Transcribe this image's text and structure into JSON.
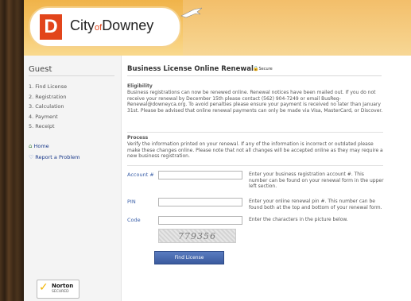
{
  "header": {
    "logo_letter": "D",
    "logo_city": "City",
    "logo_of": "of",
    "logo_name": "Downey"
  },
  "sidebar": {
    "heading": "Guest",
    "steps": [
      "1. Find License",
      "2. Registration",
      "3. Calculation",
      "4. Payment",
      "5. Receipt"
    ],
    "home_link": "Home",
    "report_link": "Report a Problem",
    "norton_title": "Norton",
    "norton_sub": "SECURED"
  },
  "main": {
    "title": "Business License Online Renewal",
    "secure_label": "Secure",
    "eligibility_heading": "Eligibility",
    "eligibility_text": "Business registrations can now be renewed online. Renewal notices have been mailed out. If you do not receive your renewal by December 15th please contact (562) 904-7249 or email BusReg-Renewal@downeyca.org. To avoid penalties please ensure your payment is received no later than January 31st. Please be advised that online renewal payments can only be made via Visa, MasterCard, or Discover.",
    "process_heading": "Process",
    "process_text": "Verify the information printed on your renewal. If any of the information is incorrect or outdated please make these changes online. Please note that not all changes will be accepted online as they may require a new business registration."
  },
  "form": {
    "account_label": "Account #",
    "account_help": "Enter your business registration account #. This number can be found on your renewal form in the upper left section.",
    "pin_label": "PIN",
    "pin_help": "Enter your online renewal pin #. This number can be found both at the top and bottom of your renewal form.",
    "code_label": "Code",
    "code_help": "Enter the characters in the picture below.",
    "captcha_text": "779356",
    "submit_label": "Find License"
  },
  "colors": {
    "header_orange": "#f0b34a",
    "logo_red": "#e2451b",
    "label_blue": "#3a5fa8",
    "button_blue": "#3a5a9e"
  }
}
